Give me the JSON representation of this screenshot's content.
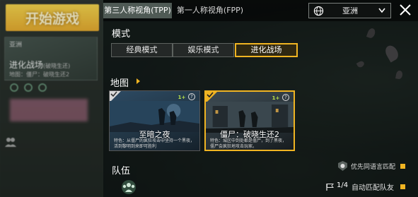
{
  "tabs": [
    {
      "label": "第三人称视角(TPP)",
      "active": true
    },
    {
      "label": "第一人称视角(FPP)",
      "active": false
    }
  ],
  "region": {
    "label": "亚洲",
    "icon": "globe-icon"
  },
  "sections": {
    "mode": "模式",
    "map": "地图",
    "team": "队伍"
  },
  "modes": [
    {
      "label": "经典模式",
      "selected": false
    },
    {
      "label": "娱乐模式",
      "selected": false
    },
    {
      "label": "进化战场",
      "selected": true
    }
  ],
  "maps": [
    {
      "name": "至暗之夜",
      "badge": "1+",
      "desc": "特色：从僵尸的疯狂攻击中坚持一个黑夜，活到黎明到来即可胜利",
      "selected": false
    },
    {
      "name": "僵尸：破晓生还2",
      "badge": "1+",
      "desc": "特色：城区中到处都是僵尸，到了黑夜，僵尸会疯狂地攻击玩家。",
      "selected": true
    }
  ],
  "team": {
    "language_match_label": "优先同语言匹配",
    "count": "1/4",
    "auto_match_label": "自动匹配队友"
  },
  "left_panel": {
    "start_label": "开始游戏",
    "region": "亚洲",
    "mode_title": "进化战场",
    "mode_sub": "(破晓生还)",
    "map_sub": "地图：僵尸：破晓生还2"
  },
  "colors": {
    "accent": "#f0b422",
    "tab_active": "#4f5a55"
  }
}
